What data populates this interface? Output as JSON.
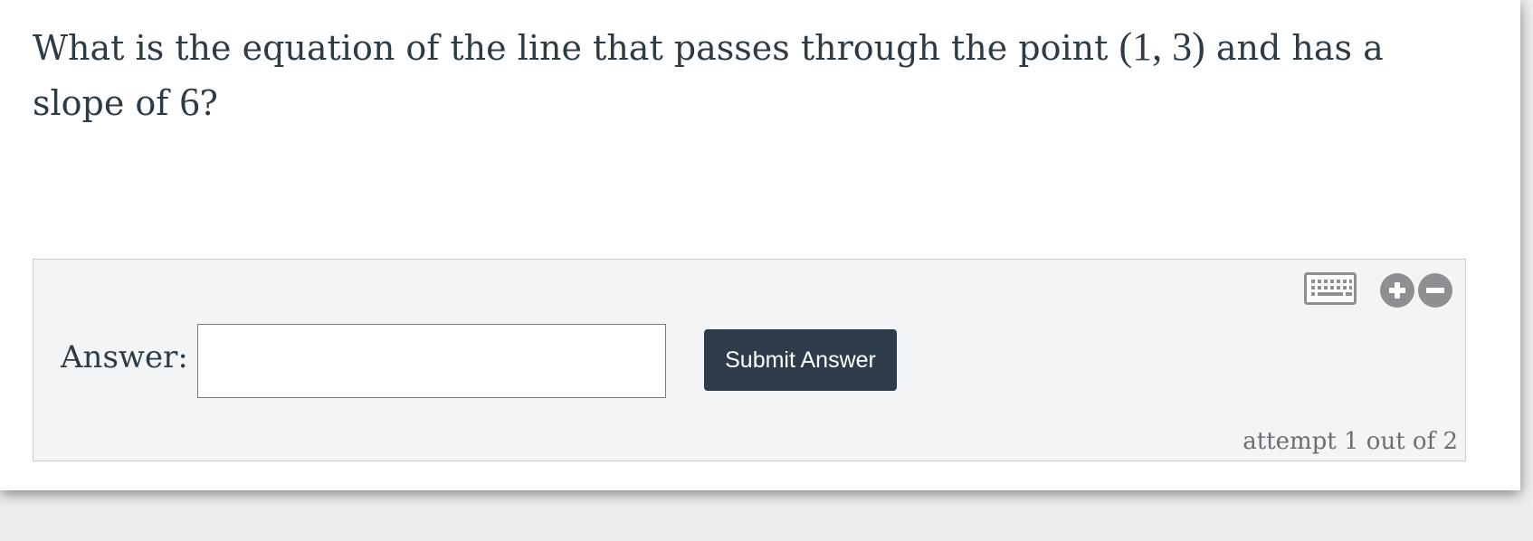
{
  "question": {
    "text_before": "What is the equation of the line that passes through the point ",
    "point": "(1, 3)",
    "text_middle": " and has a slope of ",
    "slope": "6",
    "text_after": "?"
  },
  "answer": {
    "label": "Answer:",
    "input_value": "",
    "submit_label": "Submit Answer"
  },
  "tools": {
    "keyboard_icon": "keyboard-icon",
    "zoom_in_icon": "zoom-in-icon",
    "zoom_out_icon": "zoom-out-icon"
  },
  "attempt_text": "attempt 1 out of 2",
  "colors": {
    "text": "#2d3b45",
    "panel_bg": "#f3f4f6",
    "button_bg": "#2d3b4b",
    "icon_gray": "#8d8f92"
  }
}
